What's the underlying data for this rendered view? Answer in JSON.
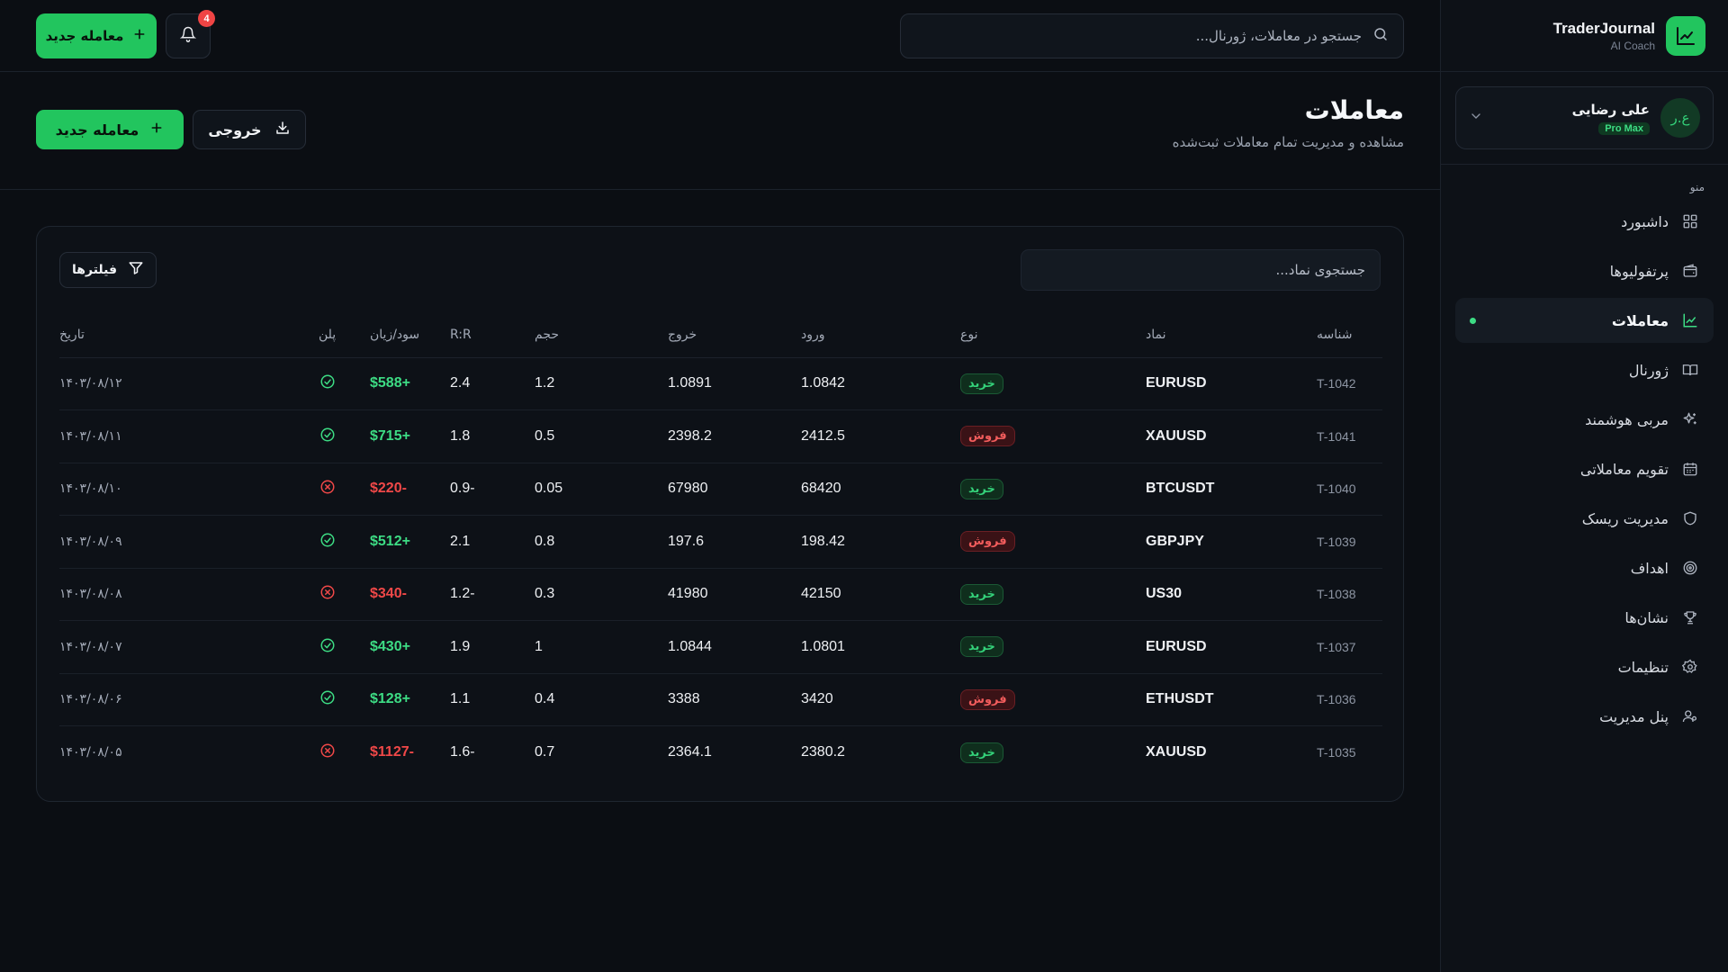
{
  "brand": {
    "title": "TraderJournal",
    "subtitle": "AI Coach"
  },
  "user": {
    "name": "علی رضایی",
    "initials": "ع.ر",
    "plan": "Pro Max"
  },
  "menu_label": "منو",
  "menu": [
    {
      "label": "داشبورد",
      "icon": "dashboard-grid-icon",
      "active": false
    },
    {
      "label": "پرتفولیوها",
      "icon": "wallet-icon",
      "active": false
    },
    {
      "label": "معاملات",
      "icon": "chart-line-icon",
      "active": true
    },
    {
      "label": "ژورنال",
      "icon": "book-open-icon",
      "active": false
    },
    {
      "label": "مربی هوشمند",
      "icon": "sparkles-icon",
      "active": false
    },
    {
      "label": "تقویم معاملاتی",
      "icon": "calendar-icon",
      "active": false
    },
    {
      "label": "مدیریت ریسک",
      "icon": "shield-icon",
      "active": false
    },
    {
      "label": "اهداف",
      "icon": "target-icon",
      "active": false
    },
    {
      "label": "نشان‌ها",
      "icon": "trophy-icon",
      "active": false
    },
    {
      "label": "تنظیمات",
      "icon": "gear-icon",
      "active": false
    },
    {
      "label": "پنل مدیریت",
      "icon": "user-admin-icon",
      "active": false
    }
  ],
  "topbar": {
    "search_placeholder": "جستجو در معاملات، ژورنال...",
    "notification_count": "4",
    "new_trade_label": "معامله جدید"
  },
  "header": {
    "title": "معاملات",
    "subtitle": "مشاهده و مدیریت تمام معاملات ثبت‌شده",
    "export_label": "خروجی",
    "new_trade_label": "معامله جدید"
  },
  "table": {
    "search_placeholder": "جستجوی نماد...",
    "filters_label": "فیلترها",
    "columns": [
      "شناسه",
      "نماد",
      "نوع",
      "ورود",
      "خروج",
      "حجم",
      "R:R",
      "سود/زیان",
      "پلن",
      "تاریخ"
    ],
    "rows": [
      {
        "id": "T-1042",
        "symbol": "EURUSD",
        "type": "خرید",
        "side": "buy",
        "entry": "1.0842",
        "exit": "1.0891",
        "volume": "1.2",
        "rr": "2.4",
        "pl": "+$588",
        "pl_sign": "pos",
        "plan": "ok",
        "date": "۱۴۰۳/۰۸/۱۲"
      },
      {
        "id": "T-1041",
        "symbol": "XAUUSD",
        "type": "فروش",
        "side": "sell",
        "entry": "2412.5",
        "exit": "2398.2",
        "volume": "0.5",
        "rr": "1.8",
        "pl": "+$715",
        "pl_sign": "pos",
        "plan": "ok",
        "date": "۱۴۰۳/۰۸/۱۱"
      },
      {
        "id": "T-1040",
        "symbol": "BTCUSDT",
        "type": "خرید",
        "side": "buy",
        "entry": "68420",
        "exit": "67980",
        "volume": "0.05",
        "rr": "-0.9",
        "pl": "-$220",
        "pl_sign": "neg",
        "plan": "bad",
        "date": "۱۴۰۳/۰۸/۱۰"
      },
      {
        "id": "T-1039",
        "symbol": "GBPJPY",
        "type": "فروش",
        "side": "sell",
        "entry": "198.42",
        "exit": "197.6",
        "volume": "0.8",
        "rr": "2.1",
        "pl": "+$512",
        "pl_sign": "pos",
        "plan": "ok",
        "date": "۱۴۰۳/۰۸/۰۹"
      },
      {
        "id": "T-1038",
        "symbol": "US30",
        "type": "خرید",
        "side": "buy",
        "entry": "42150",
        "exit": "41980",
        "volume": "0.3",
        "rr": "-1.2",
        "pl": "-$340",
        "pl_sign": "neg",
        "plan": "bad",
        "date": "۱۴۰۳/۰۸/۰۸"
      },
      {
        "id": "T-1037",
        "symbol": "EURUSD",
        "type": "خرید",
        "side": "buy",
        "entry": "1.0801",
        "exit": "1.0844",
        "volume": "1",
        "rr": "1.9",
        "pl": "+$430",
        "pl_sign": "pos",
        "plan": "ok",
        "date": "۱۴۰۳/۰۸/۰۷"
      },
      {
        "id": "T-1036",
        "symbol": "ETHUSDT",
        "type": "فروش",
        "side": "sell",
        "entry": "3420",
        "exit": "3388",
        "volume": "0.4",
        "rr": "1.1",
        "pl": "+$128",
        "pl_sign": "pos",
        "plan": "ok",
        "date": "۱۴۰۳/۰۸/۰۶"
      },
      {
        "id": "T-1035",
        "symbol": "XAUUSD",
        "type": "خرید",
        "side": "buy",
        "entry": "2380.2",
        "exit": "2364.1",
        "volume": "0.7",
        "rr": "-1.6",
        "pl": "-$1127",
        "pl_sign": "neg",
        "plan": "bad",
        "date": "۱۴۰۳/۰۸/۰۵"
      }
    ]
  },
  "colors": {
    "accent": "#22c55e",
    "profit": "#3ddc84",
    "loss": "#f04848",
    "background": "#0b0e13"
  }
}
